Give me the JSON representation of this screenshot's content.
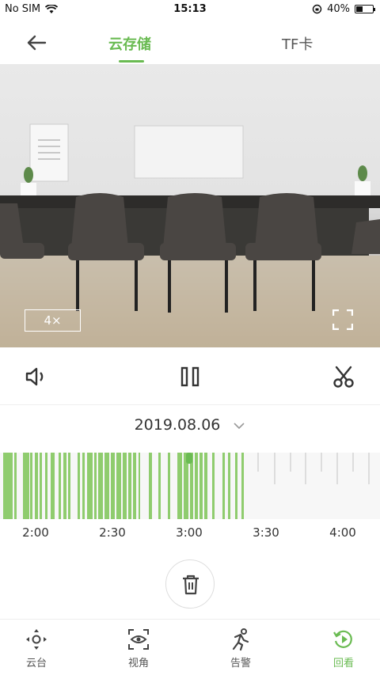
{
  "status": {
    "carrier": "No SIM",
    "time": "15:13",
    "battery": "40%",
    "battery_level": 0.4
  },
  "nav": {
    "tabs": [
      "云存储",
      "TF卡"
    ],
    "active_tab": 0
  },
  "player": {
    "speed": "4×"
  },
  "date": {
    "value": "2019.08.06"
  },
  "timeline": {
    "labels": [
      "2:00",
      "2:30",
      "3:00",
      "3:30",
      "4:00"
    ],
    "accent": "#8fcc6e"
  },
  "tabbar": {
    "items": [
      {
        "label": "云台",
        "icon": "ptz-icon"
      },
      {
        "label": "视角",
        "icon": "view-angle-icon"
      },
      {
        "label": "告警",
        "icon": "alarm-icon"
      },
      {
        "label": "回看",
        "icon": "playback-icon"
      }
    ],
    "active": 3
  },
  "colors": {
    "accent": "#6abb52",
    "recording": "#8fcc6e"
  }
}
